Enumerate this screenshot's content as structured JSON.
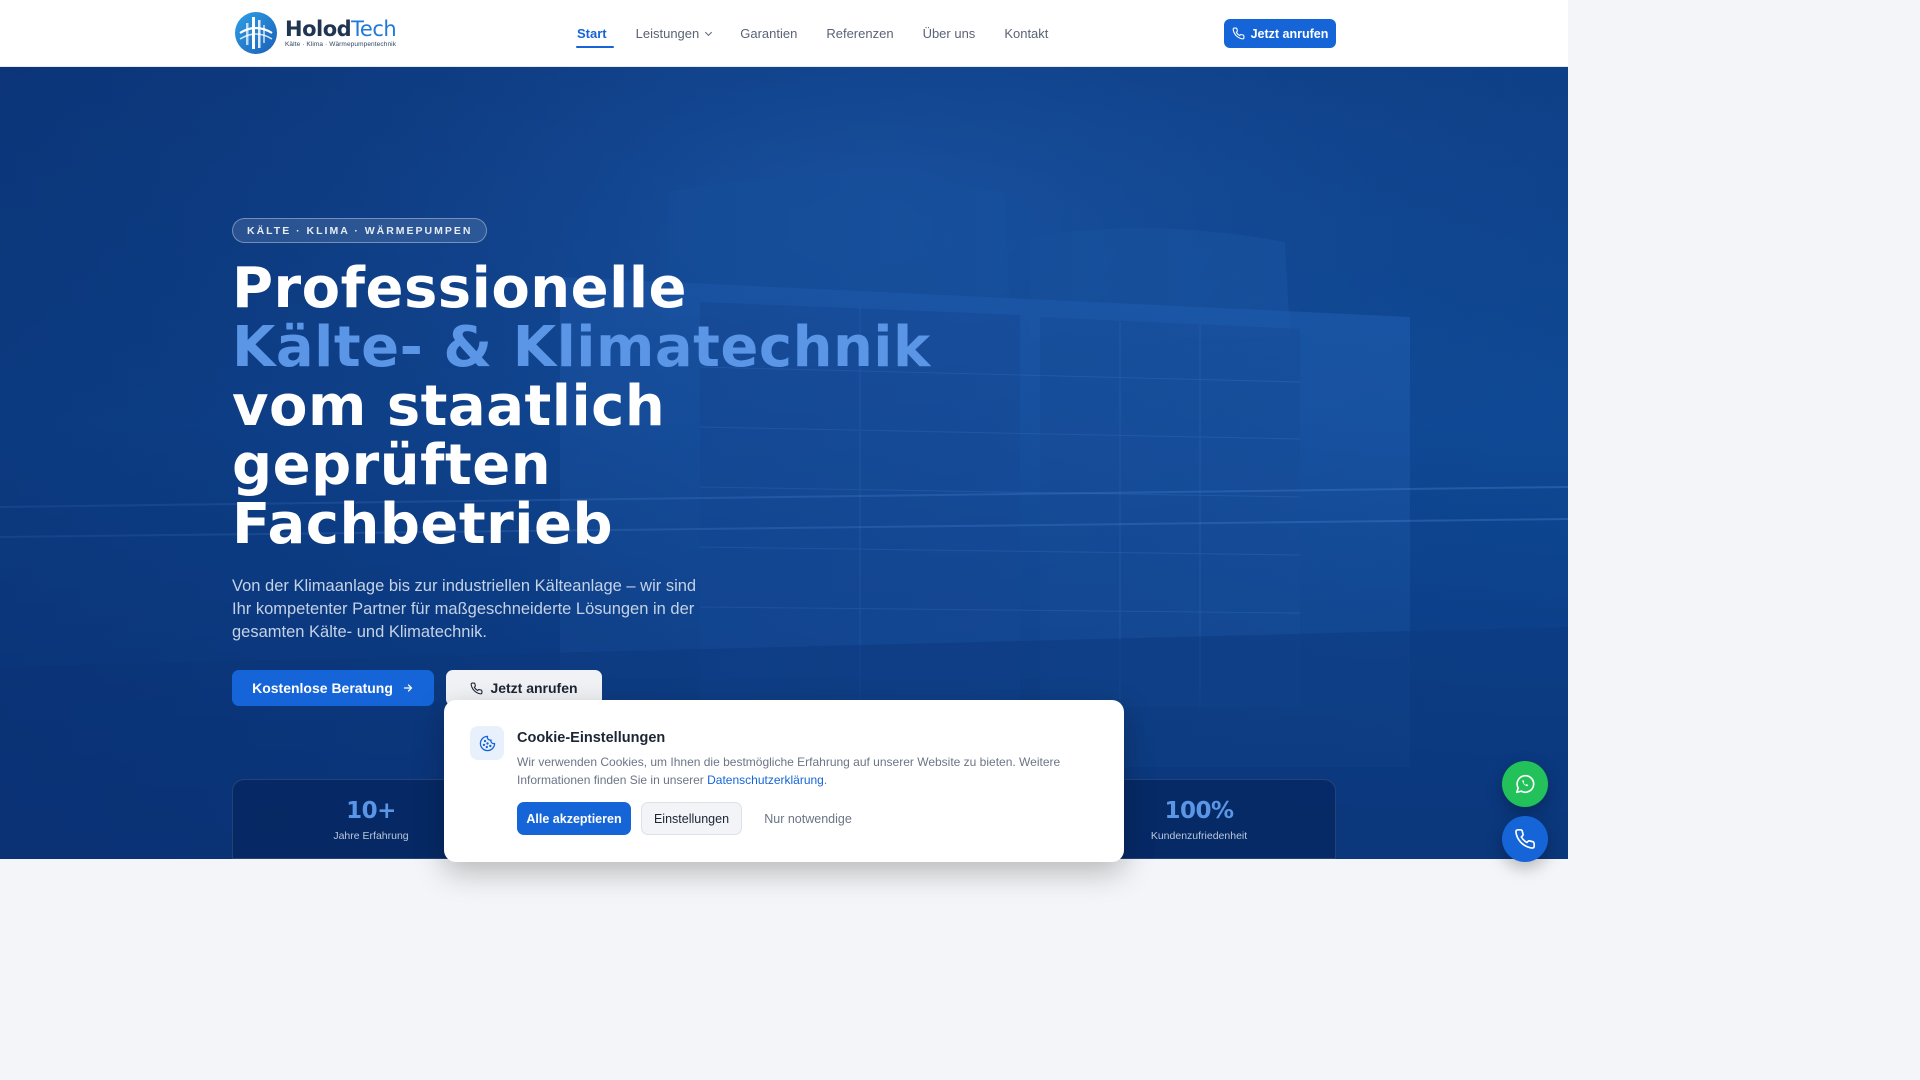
{
  "brand": {
    "name_part1": "Holod",
    "name_part2": "Tech",
    "tagline": "Kälte · Klima · Wärmepumpentechnik"
  },
  "nav": {
    "items": [
      {
        "label": "Start",
        "active": true
      },
      {
        "label": "Leistungen",
        "dropdown": true
      },
      {
        "label": "Garantien"
      },
      {
        "label": "Referenzen"
      },
      {
        "label": "Über uns"
      },
      {
        "label": "Kontakt"
      }
    ],
    "call_label": "Jetzt anrufen"
  },
  "hero": {
    "badge": "KÄLTE · KLIMA · WÄRMEPUMPEN",
    "headline": {
      "line1": "Professionelle",
      "line2": "Kälte- & Klimatechnik",
      "line3": "vom staatlich",
      "line4": "geprüften",
      "line5": "Fachbetrieb"
    },
    "subtext": "Von der Klimaanlage bis zur industriellen Kälteanlage – wir sind Ihr kompetenter Partner für maßgeschneiderte Lösungen in der gesamten Kälte- und Klimatechnik.",
    "primary_cta": "Kostenlose Beratung",
    "secondary_cta": "Jetzt anrufen"
  },
  "stats": [
    {
      "value": "10+",
      "label": "Jahre Erfahrung"
    },
    {
      "value": "100%",
      "label": "Kundenzufriedenheit"
    }
  ],
  "cookie": {
    "title": "Cookie-Einstellungen",
    "text_before": "Wir verwenden Cookies, um Ihnen die bestmögliche Erfahrung auf unserer Website zu bieten. Weitere Informationen finden Sie in unserer ",
    "link": "Datenschutzerklärung",
    "text_after": ".",
    "accept_all": "Alle akzeptieren",
    "settings": "Einstellungen",
    "necessary_only": "Nur notwendige"
  },
  "colors": {
    "accent": "#1565d8",
    "hero_blue": "#0f4a96",
    "highlight": "#5b96e6",
    "whatsapp": "#23c15a"
  },
  "icons": [
    "logo-icon",
    "chevron-down-icon",
    "phone-icon",
    "arrow-right-icon",
    "cookie-icon",
    "whatsapp-icon"
  ]
}
